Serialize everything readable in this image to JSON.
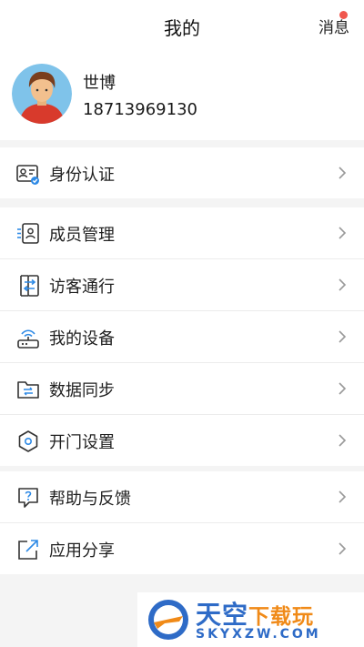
{
  "header": {
    "title": "我的",
    "messages_label": "消息"
  },
  "profile": {
    "name": "世博",
    "phone": "18713969130"
  },
  "sections": [
    {
      "items": [
        {
          "label": "身份认证",
          "icon": "id-card-icon"
        }
      ]
    },
    {
      "items": [
        {
          "label": "成员管理",
          "icon": "member-icon"
        },
        {
          "label": "访客通行",
          "icon": "visitor-pass-icon"
        },
        {
          "label": "我的设备",
          "icon": "router-device-icon"
        },
        {
          "label": "数据同步",
          "icon": "folder-sync-icon"
        },
        {
          "label": "开门设置",
          "icon": "hexagon-settings-icon"
        }
      ]
    },
    {
      "items": [
        {
          "label": "帮助与反馈",
          "icon": "help-feedback-icon"
        },
        {
          "label": "应用分享",
          "icon": "share-icon"
        }
      ]
    }
  ],
  "watermark": {
    "line1": "天空",
    "line1_accent": "下载玩",
    "line2": "SKYXZW.COM"
  },
  "colors": {
    "accent_dot": "#f0574e",
    "icon_stroke": "#333333",
    "icon_blue": "#2e8ae6"
  }
}
